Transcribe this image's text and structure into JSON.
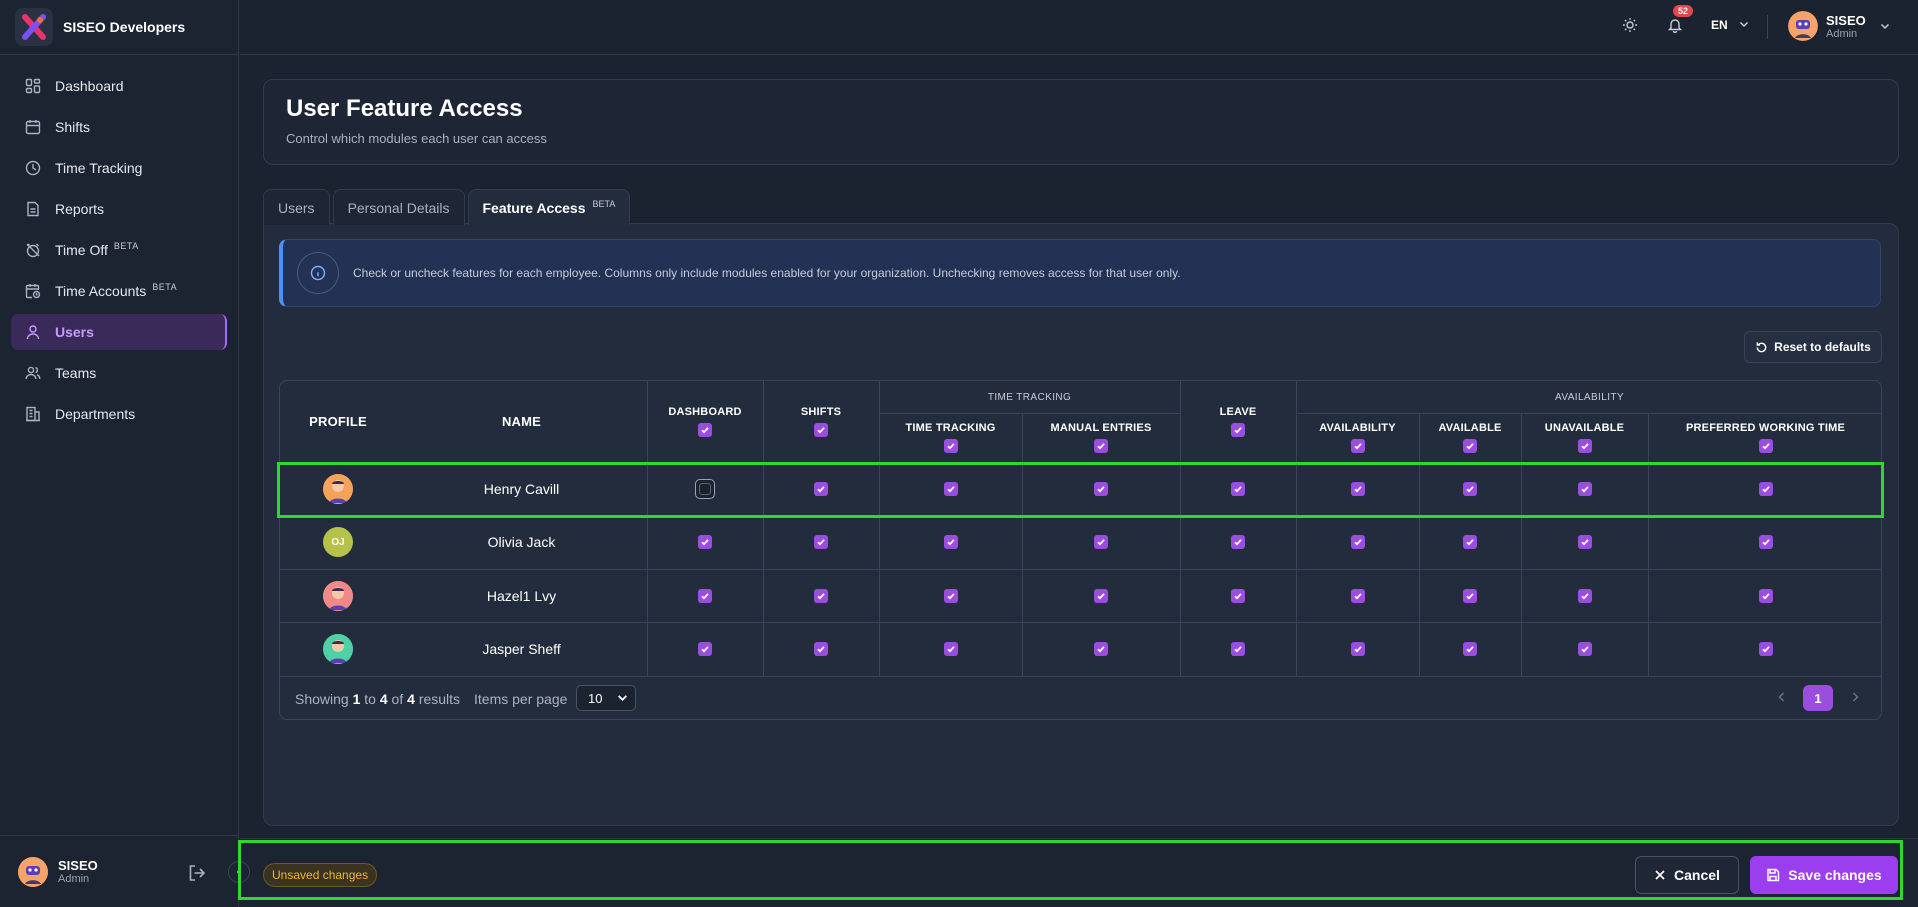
{
  "app": {
    "name": "SISEO Developers",
    "logo_icon": "siseo-logo-icon"
  },
  "sidebar": {
    "items": [
      {
        "label": "Dashboard",
        "icon": "dashboard-icon",
        "badge": ""
      },
      {
        "label": "Shifts",
        "icon": "calendar-icon",
        "badge": ""
      },
      {
        "label": "Time Tracking",
        "icon": "clock-icon",
        "badge": ""
      },
      {
        "label": "Reports",
        "icon": "report-icon",
        "badge": ""
      },
      {
        "label": "Time Off",
        "icon": "alarm-off-icon",
        "badge": "BETA"
      },
      {
        "label": "Time Accounts",
        "icon": "calendar-clock-icon",
        "badge": "BETA"
      },
      {
        "label": "Users",
        "icon": "user-icon",
        "badge": "",
        "active": true
      },
      {
        "label": "Teams",
        "icon": "team-icon",
        "badge": ""
      },
      {
        "label": "Departments",
        "icon": "building-icon",
        "badge": ""
      }
    ],
    "footer": {
      "name": "SISEO",
      "role": "Admin"
    }
  },
  "topbar": {
    "notifications": "52",
    "language": "EN",
    "user": {
      "name": "SISEO",
      "role": "Admin"
    }
  },
  "page": {
    "title": "User Feature Access",
    "subtitle": "Control which modules each user can access"
  },
  "tabs": [
    {
      "label": "Users",
      "badge": ""
    },
    {
      "label": "Personal Details",
      "badge": ""
    },
    {
      "label": "Feature Access",
      "badge": "BETA",
      "active": true
    }
  ],
  "info": {
    "text": "Check or uncheck features for each employee. Columns only include modules enabled for your organization. Unchecking removes access for that user only."
  },
  "reset_label": "Reset to defaults",
  "table": {
    "headers": {
      "profile": "PROFILE",
      "name": "NAME",
      "dashboard": "DASHBOARD",
      "shifts": "SHIFTS",
      "time_tracking_group": "TIME TRACKING",
      "time_tracking": "TIME TRACKING",
      "manual_entries": "MANUAL ENTRIES",
      "leave": "LEAVE",
      "availability_group": "AVAILABILITY",
      "availability": "AVAILABILITY",
      "available": "AVAILABLE",
      "unavailable": "UNAVAILABLE",
      "preferred_working_time": "PREFERRED WORKING TIME"
    },
    "header_checks": [
      true,
      true,
      true,
      true,
      true,
      true,
      true,
      true,
      true
    ],
    "rows": [
      {
        "name": "Henry Cavill",
        "initials": "",
        "avatar_color": "#f5a25a",
        "checks": [
          false,
          true,
          true,
          true,
          true,
          true,
          true,
          true,
          true
        ]
      },
      {
        "name": "Olivia Jack",
        "initials": "OJ",
        "avatar_color": "#b6c24a",
        "checks": [
          true,
          true,
          true,
          true,
          true,
          true,
          true,
          true,
          true
        ]
      },
      {
        "name": "Hazel1 Lvy",
        "initials": "",
        "avatar_color": "#f08a8a",
        "checks": [
          true,
          true,
          true,
          true,
          true,
          true,
          true,
          true,
          true
        ]
      },
      {
        "name": "Jasper Sheff",
        "initials": "",
        "avatar_color": "#4fd1a8",
        "checks": [
          true,
          true,
          true,
          true,
          true,
          true,
          true,
          true,
          true
        ]
      }
    ],
    "footer": {
      "showing_prefix": "Showing",
      "from": "1",
      "to_word": "to",
      "to": "4",
      "of_word": "of",
      "total": "4",
      "results_word": "results",
      "items_per_page_label": "Items per page",
      "items_per_page": "10",
      "current_page": "1"
    }
  },
  "bottom_bar": {
    "status": "Unsaved changes",
    "cancel_label": "Cancel",
    "save_label": "Save changes"
  },
  "colors": {
    "accent": "#9b4de0",
    "save": "#9b3ef0",
    "highlight": "#2dd92d",
    "warning": "#f0b43c",
    "info": "#4f8ff7"
  }
}
